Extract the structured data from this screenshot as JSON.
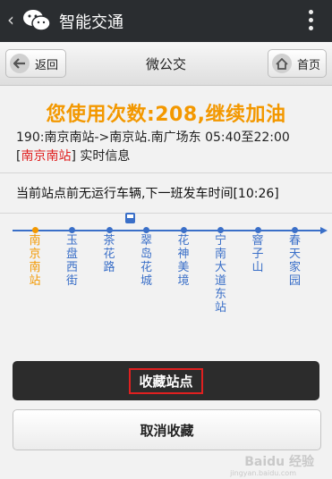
{
  "header": {
    "app_title": "智能交通"
  },
  "navbar": {
    "back_label": "返回",
    "title": "微公交",
    "home_label": "首页"
  },
  "usage_banner": "您使用次数:208,继续加油",
  "route": {
    "summary": "190:南京南站->南京站.南广场东 05:40至22:00",
    "station_prefix": "[",
    "station_name": "南京南站",
    "station_suffix": "] 实时信息"
  },
  "next_bus": "当前站点前无运行车辆,下一班发车时间[10:26]",
  "stops": [
    {
      "name": "南京南站",
      "current": true
    },
    {
      "name": "玉盘西街",
      "current": false
    },
    {
      "name": "茶花路",
      "current": false
    },
    {
      "name": "翠岛花城",
      "current": false
    },
    {
      "name": "花神美境",
      "current": false
    },
    {
      "name": "宁南大道东站",
      "current": false
    },
    {
      "name": "窨子山",
      "current": false
    },
    {
      "name": "春天家园",
      "current": false
    }
  ],
  "line_color": "#3a6fc8",
  "current_color": "#f39800",
  "buttons": {
    "favorite": "收藏站点",
    "cancel": "取消收藏"
  },
  "watermark": {
    "main": "Baidu 经验",
    "sub": "jingyan.baidu.com"
  }
}
